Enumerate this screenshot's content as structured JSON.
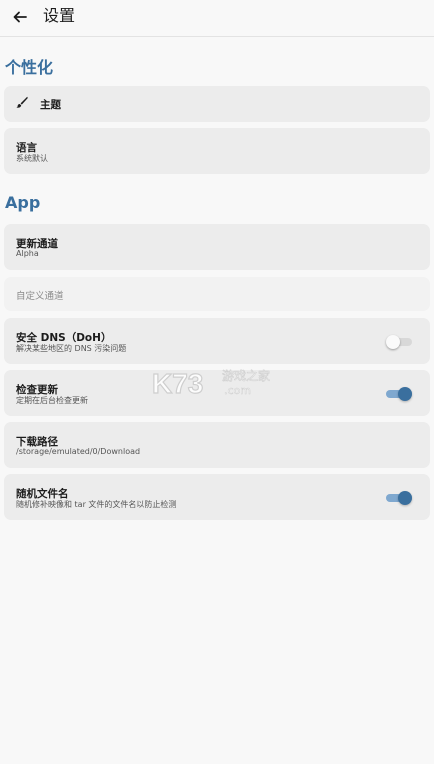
{
  "appbar": {
    "title": "设置",
    "back_icon": "arrow-left-icon"
  },
  "sections": {
    "personal": "个性化",
    "app": "App"
  },
  "theme": {
    "title": "主题",
    "icon": "brush-icon"
  },
  "language": {
    "title": "语言",
    "value": "系统默认"
  },
  "update_channel": {
    "title": "更新通道",
    "value": "Alpha"
  },
  "custom_channel": {
    "placeholder": "自定义通道"
  },
  "secure_dns": {
    "title": "安全 DNS（DoH）",
    "desc": "解决某些地区的 DNS 污染问题",
    "enabled": false
  },
  "check_update": {
    "title": "检查更新",
    "desc": "定期在后台检查更新",
    "enabled": true
  },
  "download_path": {
    "title": "下载路径",
    "value": "/storage/emulated/0/Download"
  },
  "random_filename": {
    "title": "随机文件名",
    "desc": "随机修补映像和 tar 文件的文件名以防止检测",
    "enabled": true
  },
  "watermark": {
    "brand": "K73",
    "tagline": "游戏之家",
    "domain": ".com"
  },
  "colors": {
    "accent": "#3a6f9e",
    "card": "#ececec",
    "background": "#f8f8f8"
  }
}
